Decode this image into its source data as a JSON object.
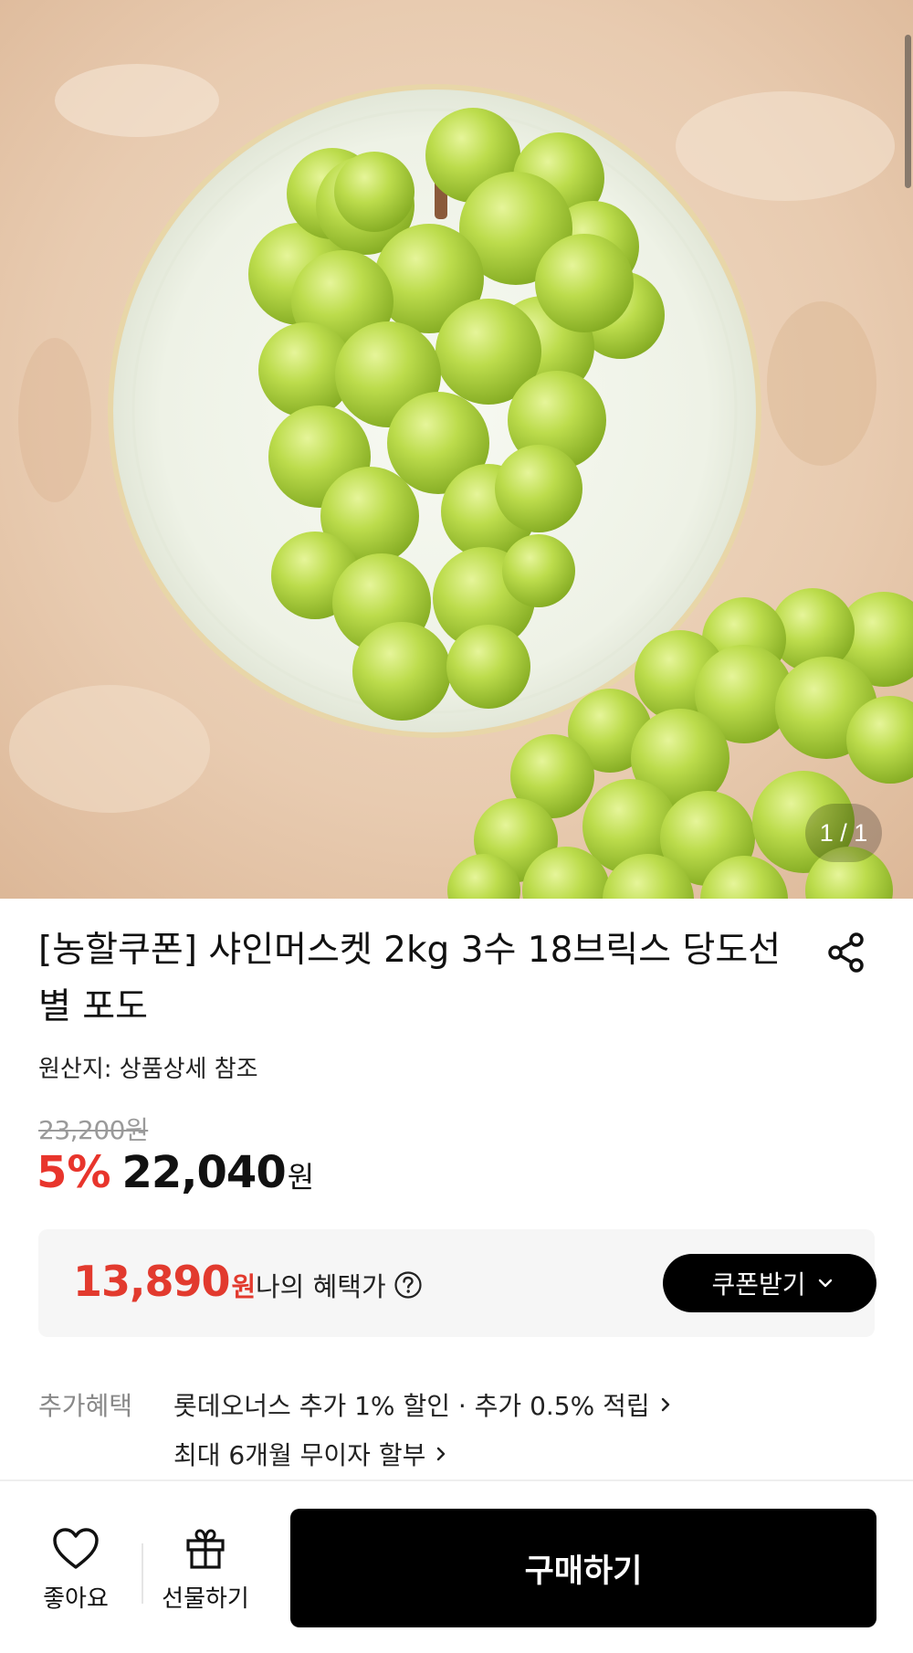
{
  "gallery": {
    "counter": "1 / 1",
    "image_alt": "shine muscat grapes on plate"
  },
  "product": {
    "title": "[농할쿠폰] 샤인머스켓 2kg 3수 18브릭스 당도선별 포도",
    "origin": "원산지: 상품상세 참조",
    "original_price": "23,200원",
    "discount": "5%",
    "sale_price": "22,040",
    "currency": "원"
  },
  "benefit": {
    "price": "13,890",
    "currency": "원",
    "label": "나의 혜택가",
    "coupon_button": "쿠폰받기"
  },
  "extra": {
    "label": "추가혜택",
    "lines": [
      "롯데오너스 추가 1% 할인 · 추가 0.5% 적립",
      "최대 6개월 무이자 할부"
    ]
  },
  "bottom_bar": {
    "like_label": "좋아요",
    "gift_label": "선물하기",
    "buy_label": "구매하기"
  },
  "colors": {
    "accent_red": "#e8352c",
    "button_black": "#000000"
  },
  "icons": [
    "share-icon",
    "question-icon",
    "chevron-down-icon",
    "chevron-right-icon",
    "heart-icon",
    "gift-icon"
  ]
}
